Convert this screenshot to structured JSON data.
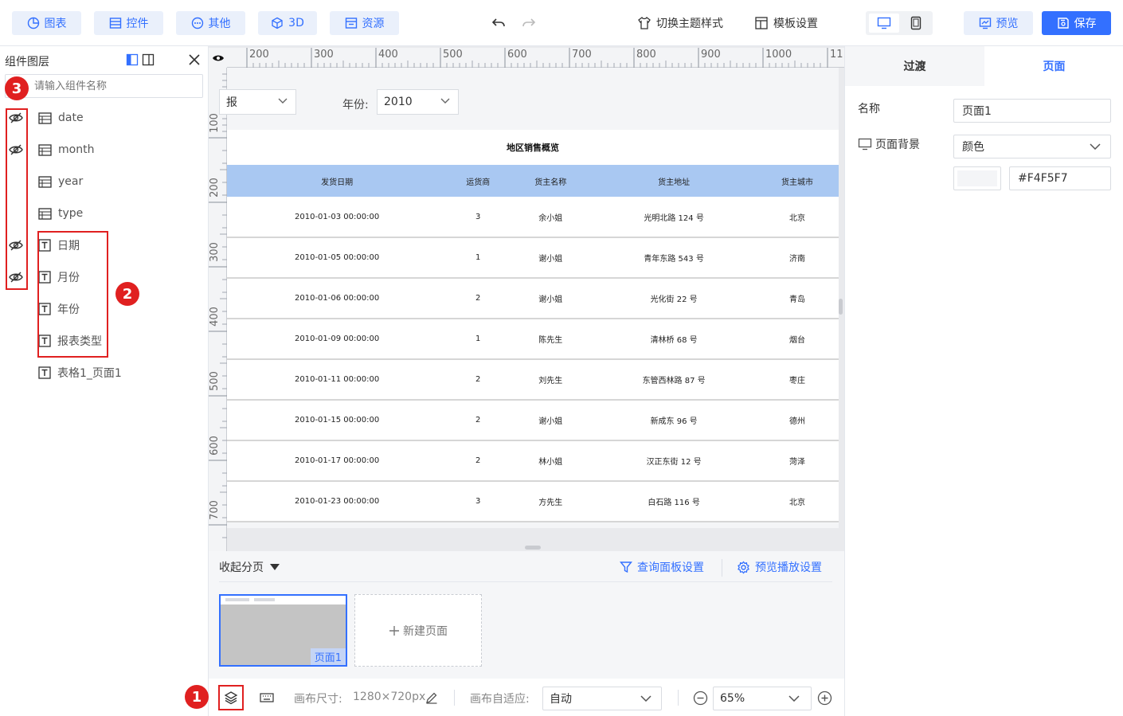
{
  "toolbar": {
    "chart": "图表",
    "widget": "控件",
    "other": "其他",
    "threeD": "3D",
    "resource": "资源",
    "theme": "切换主题样式",
    "template": "模板设置",
    "preview": "预览",
    "save": "保存"
  },
  "left": {
    "title": "组件图层",
    "search_placeholder": "请输入组件名称",
    "items": [
      "date",
      "month",
      "year",
      "type",
      "日期",
      "月份",
      "年份",
      "报表类型",
      "表格1_页面1"
    ]
  },
  "ruler": {
    "h": [
      "200",
      "300",
      "400",
      "500",
      "600",
      "700",
      "800",
      "900",
      "1000",
      "11"
    ],
    "v": [
      "100",
      "200",
      "300",
      "400",
      "500",
      "600",
      "700"
    ]
  },
  "canvas": {
    "filter1_value": "报",
    "year_label": "年份:",
    "year_value": "2010",
    "table_title": "地区销售概览",
    "columns": [
      "发货日期",
      "运货商",
      "货主名称",
      "货主地址",
      "货主城市"
    ],
    "rows": [
      [
        "2010-01-03 00:00:00",
        "3",
        "余小姐",
        "光明北路 124 号",
        "北京"
      ],
      [
        "2010-01-05 00:00:00",
        "1",
        "谢小姐",
        "青年东路 543 号",
        "济南"
      ],
      [
        "2010-01-06 00:00:00",
        "2",
        "谢小姐",
        "光化街 22 号",
        "青岛"
      ],
      [
        "2010-01-09 00:00:00",
        "1",
        "陈先生",
        "清林桥 68 号",
        "烟台"
      ],
      [
        "2010-01-11 00:00:00",
        "2",
        "刘先生",
        "东管西林路 87 号",
        "枣庄"
      ],
      [
        "2010-01-15 00:00:00",
        "2",
        "谢小姐",
        "新成东 96 号",
        "德州"
      ],
      [
        "2010-01-17 00:00:00",
        "2",
        "林小姐",
        "汉正东街 12 号",
        "菏泽"
      ],
      [
        "2010-01-23 00:00:00",
        "3",
        "方先生",
        "白石路 116 号",
        "北京"
      ]
    ]
  },
  "pages": {
    "collapse": "收起分页",
    "query_settings": "查询面板设置",
    "play_settings": "预览播放设置",
    "page1": "页面1",
    "new_page": "新建页面"
  },
  "status": {
    "canvas_size_label": "画布尺寸:",
    "canvas_size": "1280×720px",
    "adapt_label": "画布自适应:",
    "adapt_value": "自动",
    "zoom": "65%"
  },
  "right": {
    "tab_transition": "过渡",
    "tab_page": "页面",
    "name_label": "名称",
    "name_value": "页面1",
    "bg_label": "页面背景",
    "bg_type": "颜色",
    "bg_color": "#F4F5F7"
  },
  "badges": [
    "1",
    "2",
    "3"
  ],
  "colors": {
    "accent": "#3370ff",
    "highlight": "#e02020",
    "header": "#a9c8f2"
  }
}
